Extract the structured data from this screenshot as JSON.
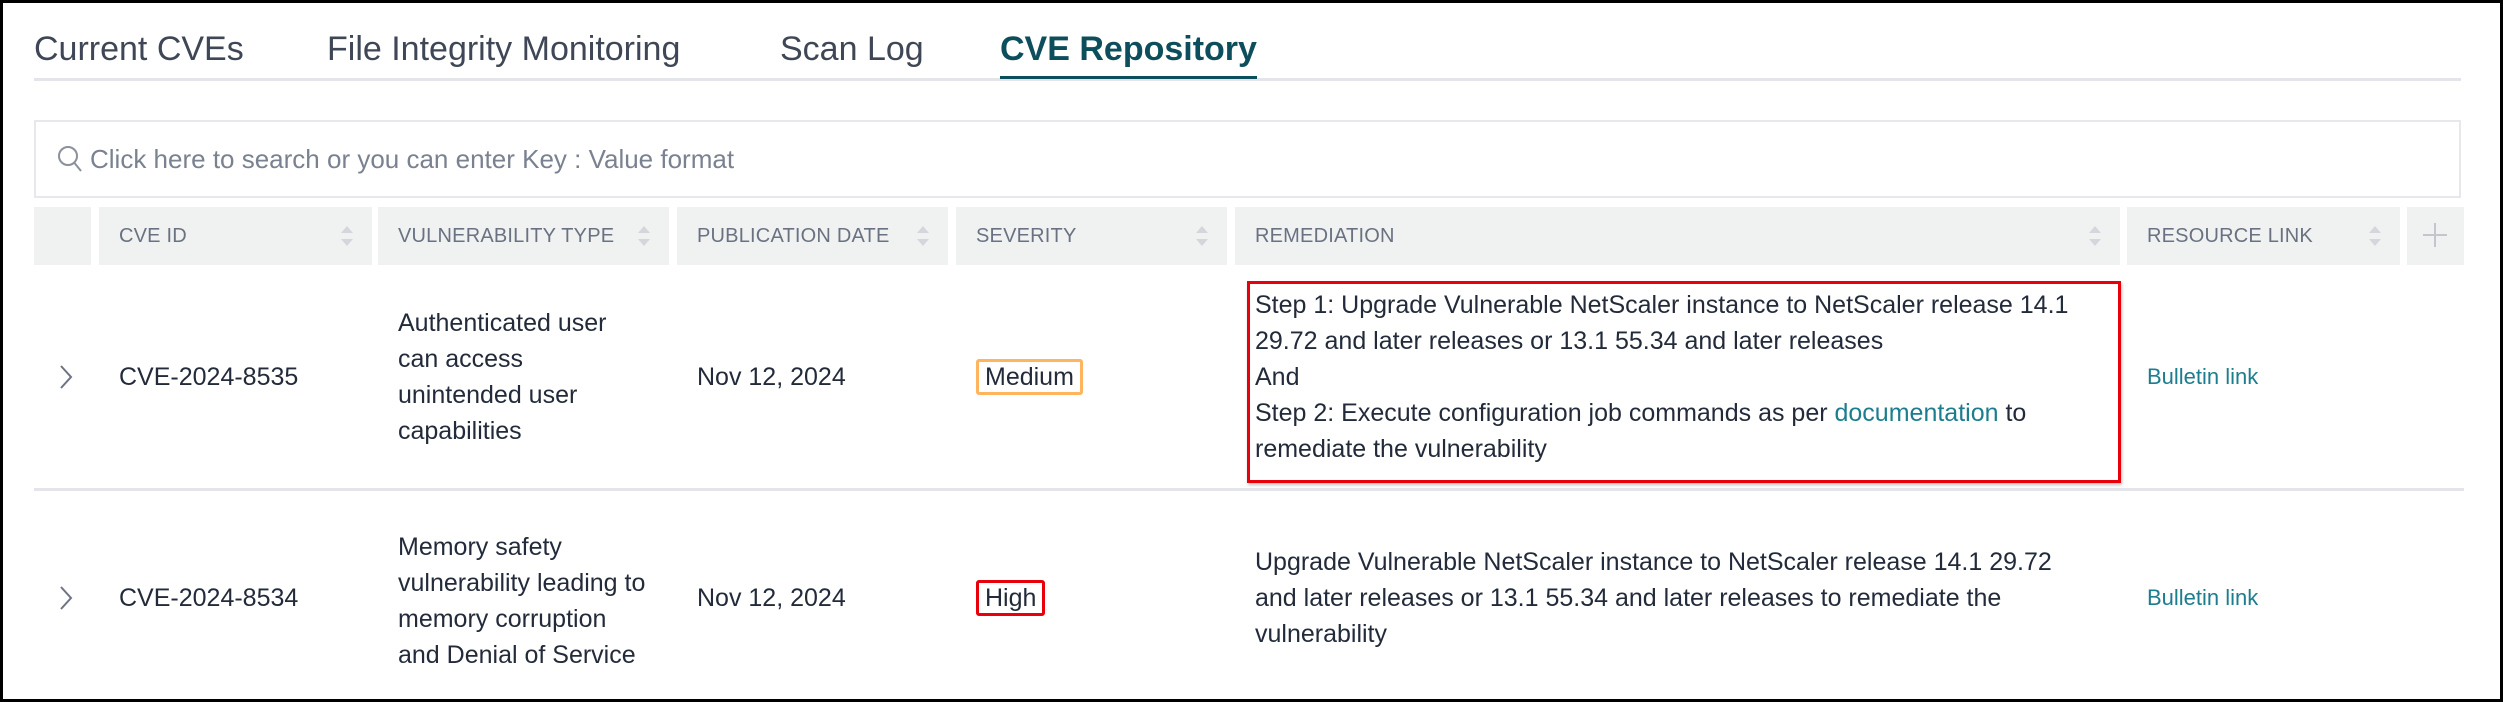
{
  "tabs": [
    {
      "label": "Current CVEs",
      "active": false
    },
    {
      "label": "File Integrity Monitoring",
      "active": false
    },
    {
      "label": "Scan Log",
      "active": false
    },
    {
      "label": "CVE Repository",
      "active": true
    }
  ],
  "search": {
    "placeholder": "Click here to search or you can enter Key : Value format",
    "value": ""
  },
  "table": {
    "columns": [
      {
        "label": "CVE ID",
        "sortable": true
      },
      {
        "label": "VULNERABILITY TYPE",
        "sortable": true
      },
      {
        "label": "PUBLICATION DATE",
        "sortable": true
      },
      {
        "label": "SEVERITY",
        "sortable": true
      },
      {
        "label": "REMEDIATION",
        "sortable": true
      },
      {
        "label": "RESOURCE LINK",
        "sortable": true
      }
    ],
    "add_column_icon": "plus-icon",
    "rows": [
      {
        "cve_id": "CVE-2024-8535",
        "vulnerability_type": "Authenticated user can access unintended user capabilities",
        "publication_date": "Nov 12, 2024",
        "severity": "Medium",
        "remediation": {
          "line1": "Step 1: Upgrade Vulnerable NetScaler instance to NetScaler release 14.1 29.72 and later releases or 13.1 55.34 and later releases",
          "line2": "And",
          "line3_prefix": "Step 2: Execute configuration job commands as per ",
          "line3_link": "documentation",
          "line3_suffix": " to remediate the vulnerability"
        },
        "resource_link": "Bulletin link"
      },
      {
        "cve_id": "CVE-2024-8534",
        "vulnerability_type": "Memory safety vulnerability leading to memory corruption and Denial of Service",
        "publication_date": "Nov 12, 2024",
        "severity": "High",
        "remediation": {
          "text": "Upgrade Vulnerable NetScaler instance to NetScaler release 14.1 29.72 and later releases or 13.1 55.34 and later releases to remediate the vulnerability"
        },
        "resource_link": "Bulletin link"
      }
    ]
  },
  "colors": {
    "accent": "#0d4e5c",
    "link": "#1c7d8e",
    "severity_medium": "#ffb45e",
    "severity_high": "#e8000b",
    "annotation_box": "#e8000b"
  }
}
